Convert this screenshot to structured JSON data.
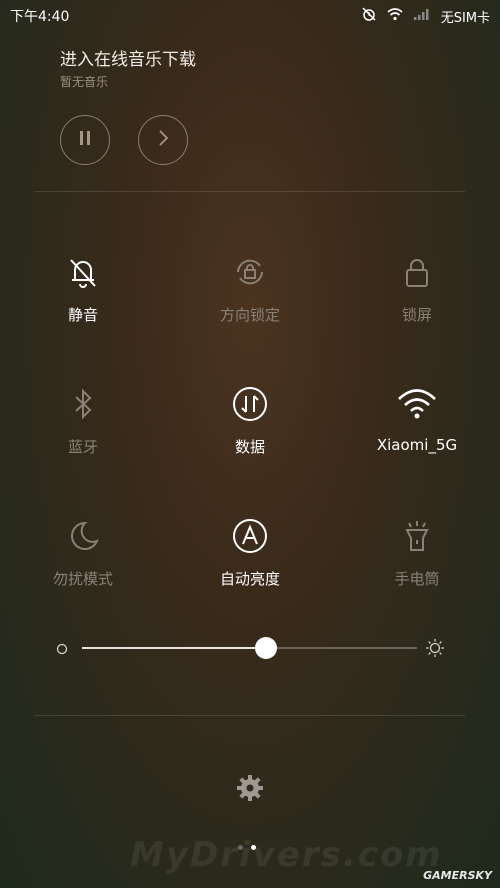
{
  "status": {
    "time": "下午4:40",
    "sim": "无SIM卡",
    "icons": [
      "alarm-off-icon",
      "wifi-icon",
      "signal-icon"
    ]
  },
  "music": {
    "title": "进入在线音乐下载",
    "subtitle": "暂无音乐",
    "buttons": [
      "pause-icon",
      "next-icon"
    ]
  },
  "toggles": [
    {
      "label": "静音",
      "icon": "mute-icon",
      "active": true
    },
    {
      "label": "方向锁定",
      "icon": "rotation-lock-icon",
      "active": false
    },
    {
      "label": "锁屏",
      "icon": "lock-icon",
      "active": false
    },
    {
      "label": "蓝牙",
      "icon": "bluetooth-icon",
      "active": false
    },
    {
      "label": "数据",
      "icon": "mobile-data-icon",
      "active": true
    },
    {
      "label": "Xiaomi_5G",
      "icon": "wifi-icon",
      "active": true
    },
    {
      "label": "勿扰模式",
      "icon": "moon-icon",
      "active": false
    },
    {
      "label": "自动亮度",
      "icon": "auto-brightness-icon",
      "active": true
    },
    {
      "label": "手电筒",
      "icon": "flashlight-icon",
      "active": false
    }
  ],
  "brightness": {
    "level": 0.55
  },
  "pages": {
    "count": 2,
    "active": 1
  },
  "watermark": "MyDrivers.com",
  "brand": "GAMERSKY"
}
